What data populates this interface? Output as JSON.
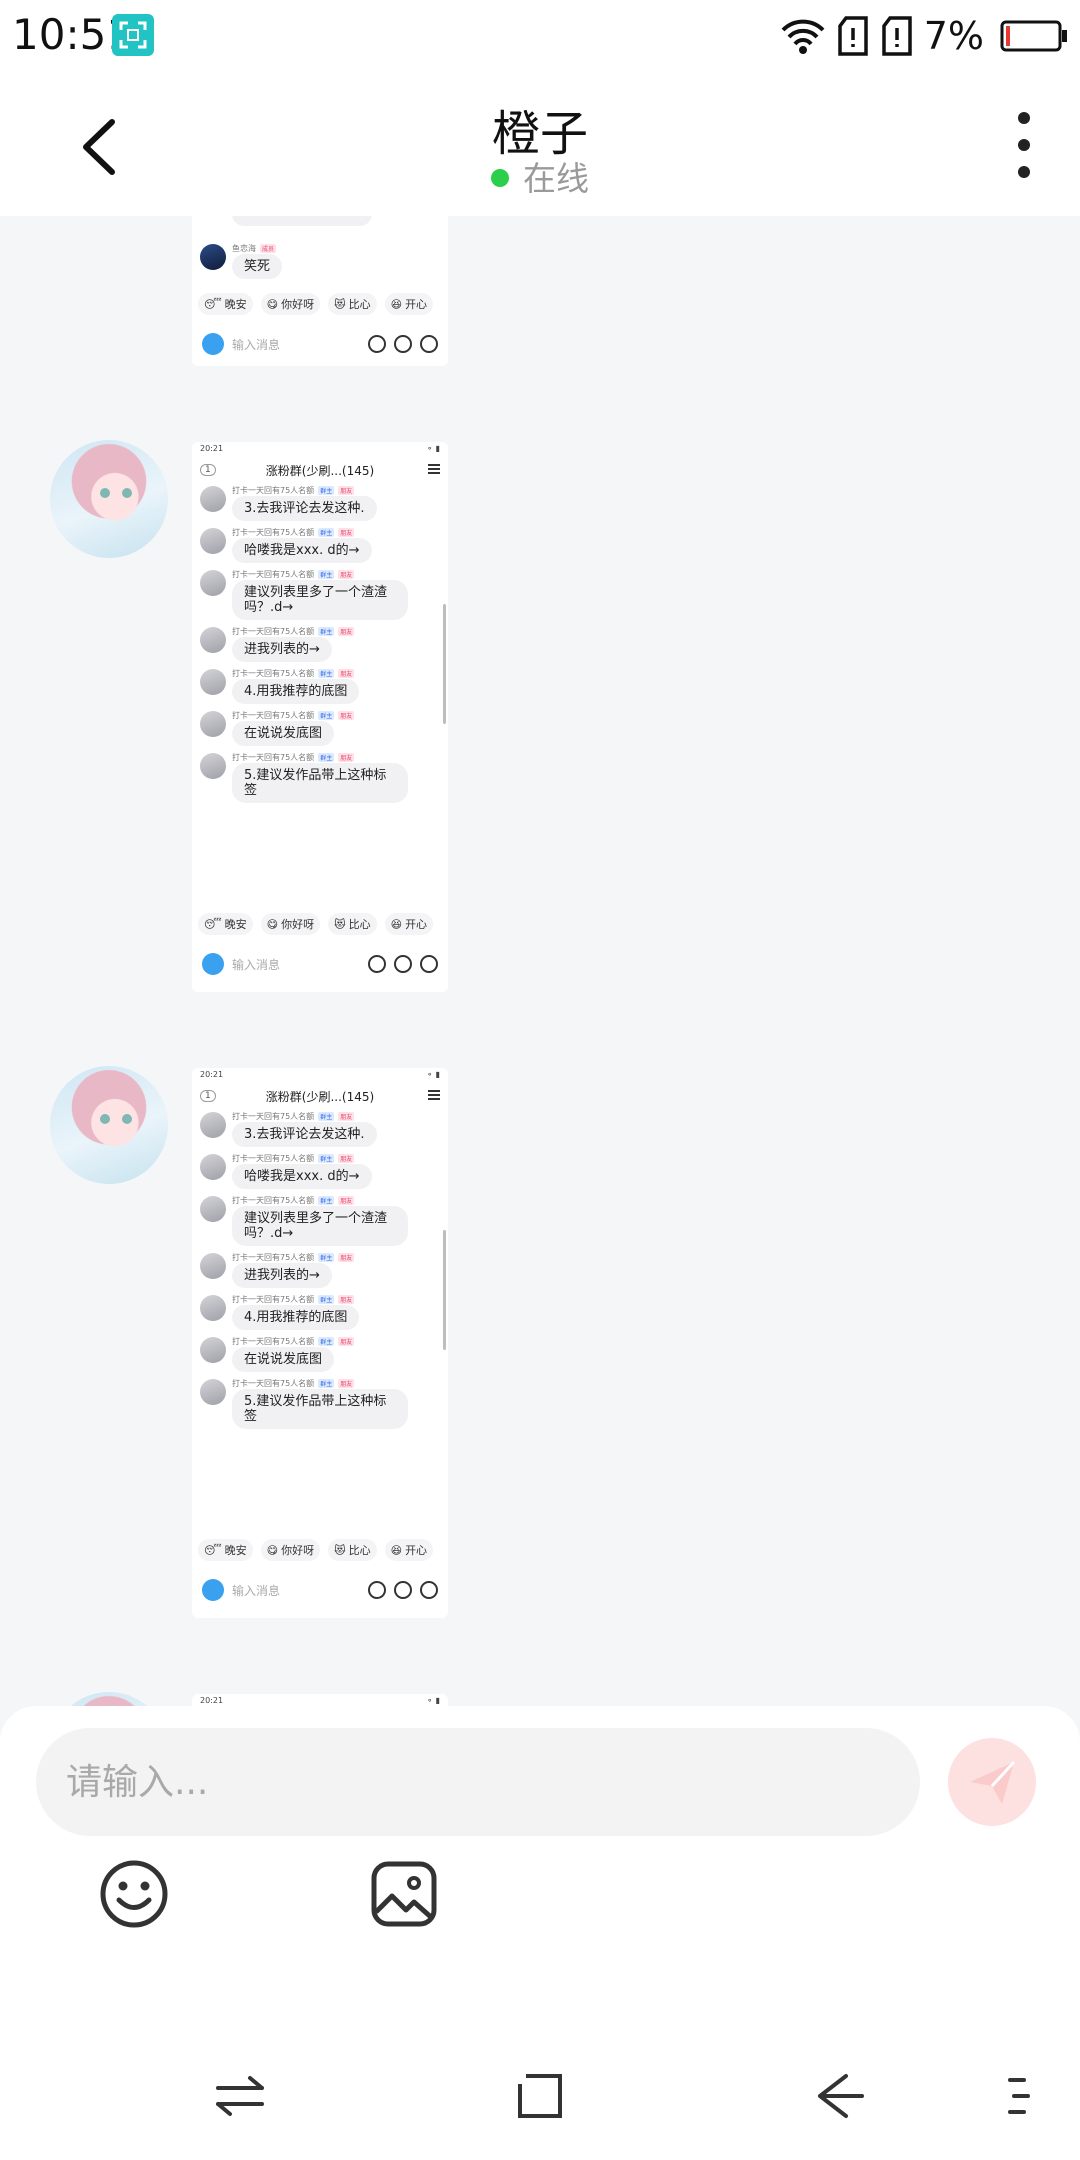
{
  "status_bar": {
    "time": "10:51",
    "battery_percent": "7%",
    "battery_level": 0.07
  },
  "header": {
    "title": "橙子",
    "status": "在线"
  },
  "first_shot_partial": {
    "last_name": "鱼恋海",
    "last_badge": "成员",
    "last_message": "笑死"
  },
  "shot": {
    "status_time": "20:21",
    "group_name": "涨粉群(少刷...(145)",
    "back_badge": "1",
    "sender_name": "打卡一天回有75人名额",
    "tag_blue": "群主",
    "tag_red": "朋友",
    "messages": [
      "3.去我评论去发这种.",
      "哈喽我是xxx. d的→",
      "建议列表里多了一个渣渣吗？.d→",
      "进我列表的→",
      "4.用我推荐的底图",
      "在说说发底图",
      "5.建议发作品带上这种标签"
    ],
    "quick_replies": [
      "晚安",
      "你好呀",
      "比心",
      "开心"
    ],
    "input_placeholder": "输入消息"
  },
  "composer": {
    "placeholder": "请输入..."
  },
  "icons": {
    "back": "back-arrow-icon",
    "more": "more-vertical-icon",
    "emoji": "emoji-icon",
    "image": "image-icon",
    "send": "send-icon"
  },
  "colors": {
    "online": "#2bcf4b",
    "send_disabled": "#fde0e0",
    "accent_teal": "#22c3c3"
  }
}
